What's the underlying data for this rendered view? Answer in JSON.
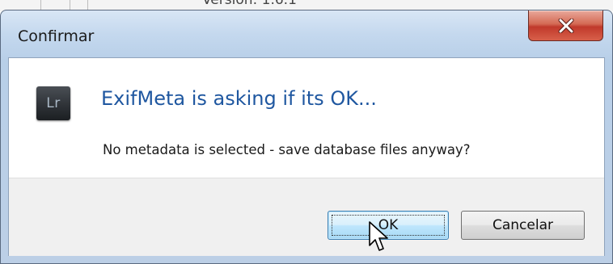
{
  "background_window": {
    "text": "Version: 1.6.1"
  },
  "dialog": {
    "title": "Confirmar",
    "close_icon": "close-icon",
    "app_icon_text": "Lr",
    "headline": "ExifMeta is asking if its OK...",
    "message": "No metadata is selected - save database files anyway?",
    "buttons": {
      "ok_label": "OK",
      "cancel_label": "Cancelar"
    }
  },
  "colors": {
    "headline": "#1f57a0",
    "close_button": "#c0392b",
    "titlebar": "#c4d8ee"
  }
}
